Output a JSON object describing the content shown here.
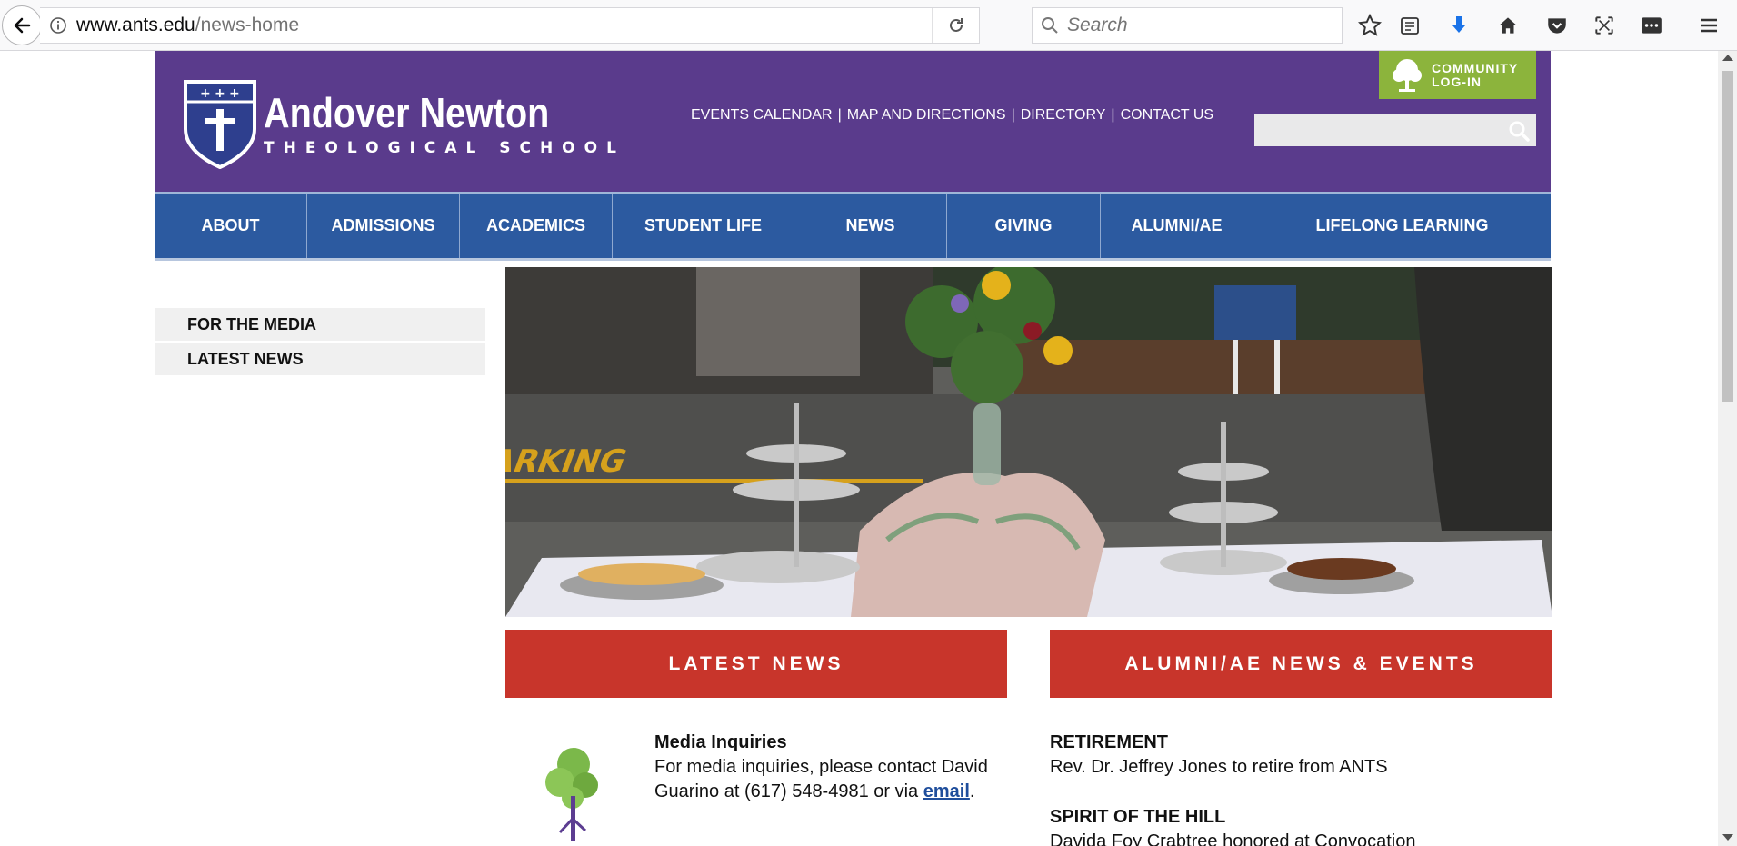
{
  "browser": {
    "url_host": "www.ants.edu",
    "url_path": "/news-home",
    "search_placeholder": "Search"
  },
  "header": {
    "logo_name": "Andover Newton",
    "logo_sub": "THEOLOGICAL SCHOOL",
    "utility_links": [
      "EVENTS CALENDAR",
      "MAP AND DIRECTIONS",
      "DIRECTORY",
      "CONTACT US"
    ],
    "community_line1": "COMMUNITY",
    "community_line2": "LOG-IN"
  },
  "nav": [
    "ABOUT",
    "ADMISSIONS",
    "ACADEMICS",
    "STUDENT LIFE",
    "NEWS",
    "GIVING",
    "ALUMNI/AE",
    "LIFELONG LEARNING"
  ],
  "sidebar": [
    "FOR THE MEDIA",
    "LATEST NEWS"
  ],
  "sections": {
    "latest_news": "LATEST NEWS",
    "alumni_news": "ALUMNI/AE NEWS & EVENTS"
  },
  "news": {
    "title": "Media Inquiries",
    "body_before": "For media inquiries, please contact David Guarino at (617) 548-4981 or via ",
    "link": "email",
    "body_after": "."
  },
  "alumni": [
    {
      "title": "RETIREMENT",
      "text": "Rev. Dr. Jeffrey Jones to retire from ANTS"
    },
    {
      "title": "SPIRIT OF THE HILL",
      "text": "Davida Foy Crabtree honored at Convocation"
    }
  ],
  "colors": {
    "header_purple": "#5a3b8c",
    "nav_blue": "#2c5aa0",
    "community_green": "#8cb43c",
    "section_red": "#c8352b"
  }
}
